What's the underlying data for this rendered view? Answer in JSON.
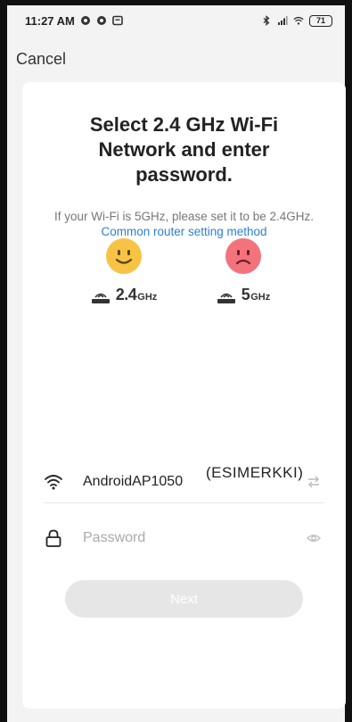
{
  "status_bar": {
    "time": "11:27 AM",
    "battery": "71",
    "icons": [
      "chrome-icon",
      "chrome-icon",
      "message-icon",
      "bluetooth-icon",
      "signal-icon",
      "wifi-icon",
      "battery-icon"
    ]
  },
  "header": {
    "cancel_label": "Cancel"
  },
  "card": {
    "title": "Select 2.4 GHz Wi-Fi Network and enter password.",
    "hint_text": "If your Wi-Fi is 5GHz, please set it to be 2.4GHz.",
    "hint_link": "Common router setting method"
  },
  "bands": [
    {
      "number": "2.4",
      "unit": "GHz",
      "face": "happy-face-icon",
      "color": "#f6c344"
    },
    {
      "number": "5",
      "unit": "GHz",
      "face": "sad-face-icon",
      "color": "#f3727c"
    }
  ],
  "form": {
    "ssid_value": "AndroidAP1050",
    "ssid_annotation": "(ESIMERKKI)",
    "password_placeholder": "Password",
    "next_label": "Next"
  },
  "colors": {
    "link": "#2a7fd6",
    "disabled_button": "#e6e6e6"
  }
}
